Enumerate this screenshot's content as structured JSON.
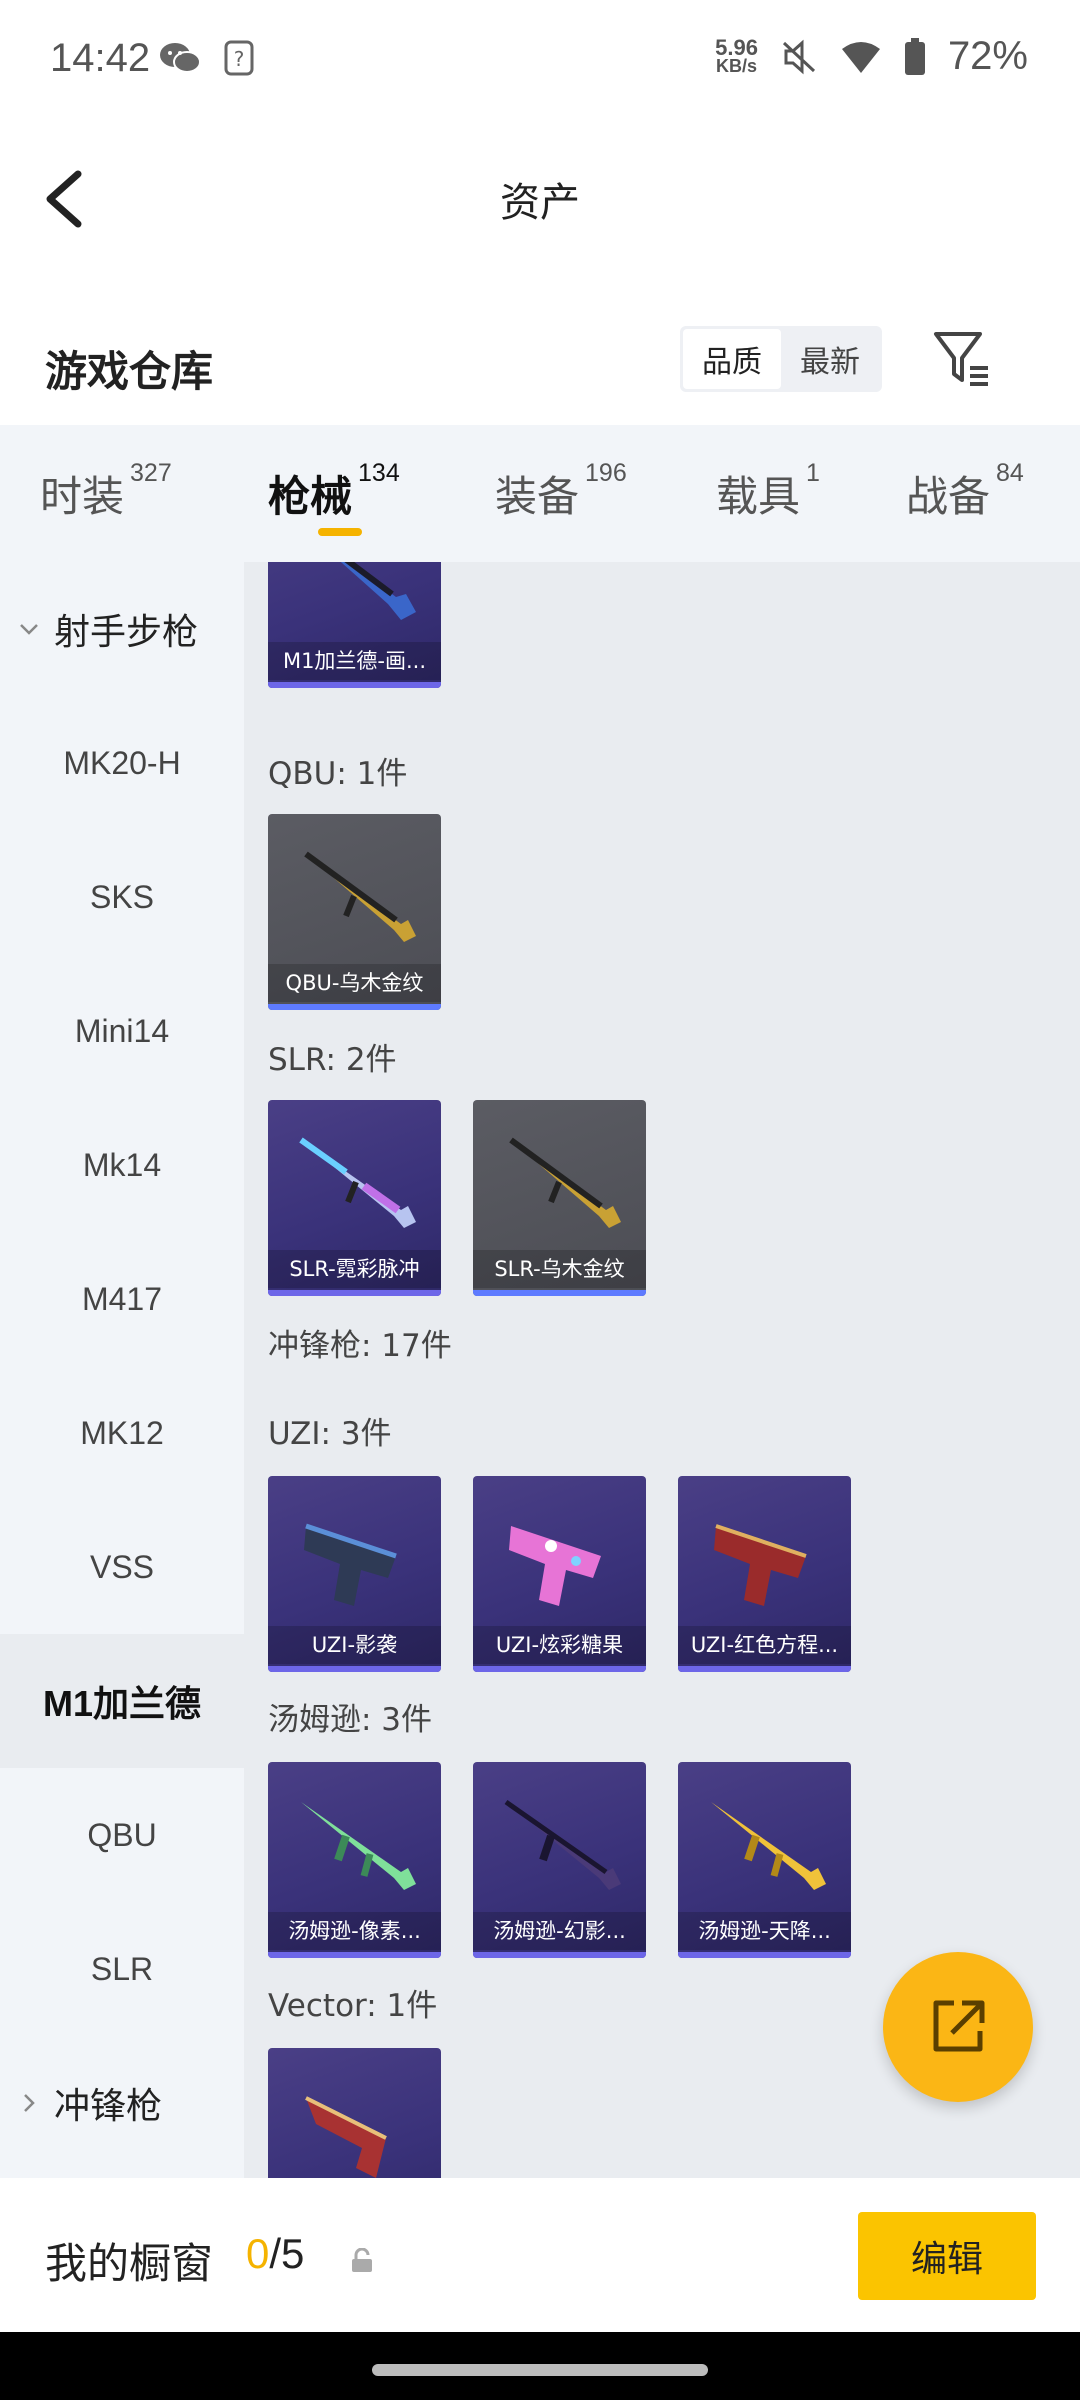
{
  "status_bar": {
    "time": "14:42",
    "net_speed_value": "5.96",
    "net_speed_unit": "KB/s",
    "battery": "72%"
  },
  "header": {
    "title": "资产",
    "back_icon": "chevron-left-icon"
  },
  "warehouse": {
    "title": "游戏仓库",
    "sort_options": [
      "品质",
      "最新"
    ],
    "sort_selected": "品质",
    "filter_icon": "filter-icon"
  },
  "tabs": [
    {
      "label": "时装",
      "count": "327"
    },
    {
      "label": "枪械",
      "count": "134",
      "active": true
    },
    {
      "label": "装备",
      "count": "196"
    },
    {
      "label": "载具",
      "count": "1"
    },
    {
      "label": "战备",
      "count": "84"
    }
  ],
  "sidebar": {
    "group_rifle": "射手步枪",
    "items": [
      "MK20-H",
      "SKS",
      "Mini14",
      "Mk14",
      "M417",
      "MK12",
      "VSS",
      "M1加兰德",
      "QBU",
      "SLR"
    ],
    "active_item": "M1加兰德",
    "group_smg": "冲锋枪"
  },
  "content": {
    "m1_card": "M1加兰德-画...",
    "qbu_label": "QBU: 1件",
    "qbu_cards": [
      "QBU-乌木金纹"
    ],
    "slr_label": "SLR: 2件",
    "slr_cards": [
      "SLR-霓彩脉冲",
      "SLR-乌木金纹"
    ],
    "smg_label": "冲锋枪: 17件",
    "uzi_label": "UZI: 3件",
    "uzi_cards": [
      "UZI-影袭",
      "UZI-炫彩糖果",
      "UZI-红色方程..."
    ],
    "thompson_label": "汤姆逊: 3件",
    "thompson_cards": [
      "汤姆逊-像素...",
      "汤姆逊-幻影...",
      "汤姆逊-天降..."
    ],
    "vector_label": "Vector: 1件"
  },
  "float_button": {
    "icon": "share-external-icon"
  },
  "bottom": {
    "showcase_label": "我的橱窗",
    "showcase_current": "0",
    "showcase_total": "/5",
    "edit_label": "编辑"
  },
  "colors": {
    "accent": "#f5b300",
    "button": "#fbc400",
    "card_purple": "#3a327a",
    "card_gray": "#4c4d54"
  }
}
